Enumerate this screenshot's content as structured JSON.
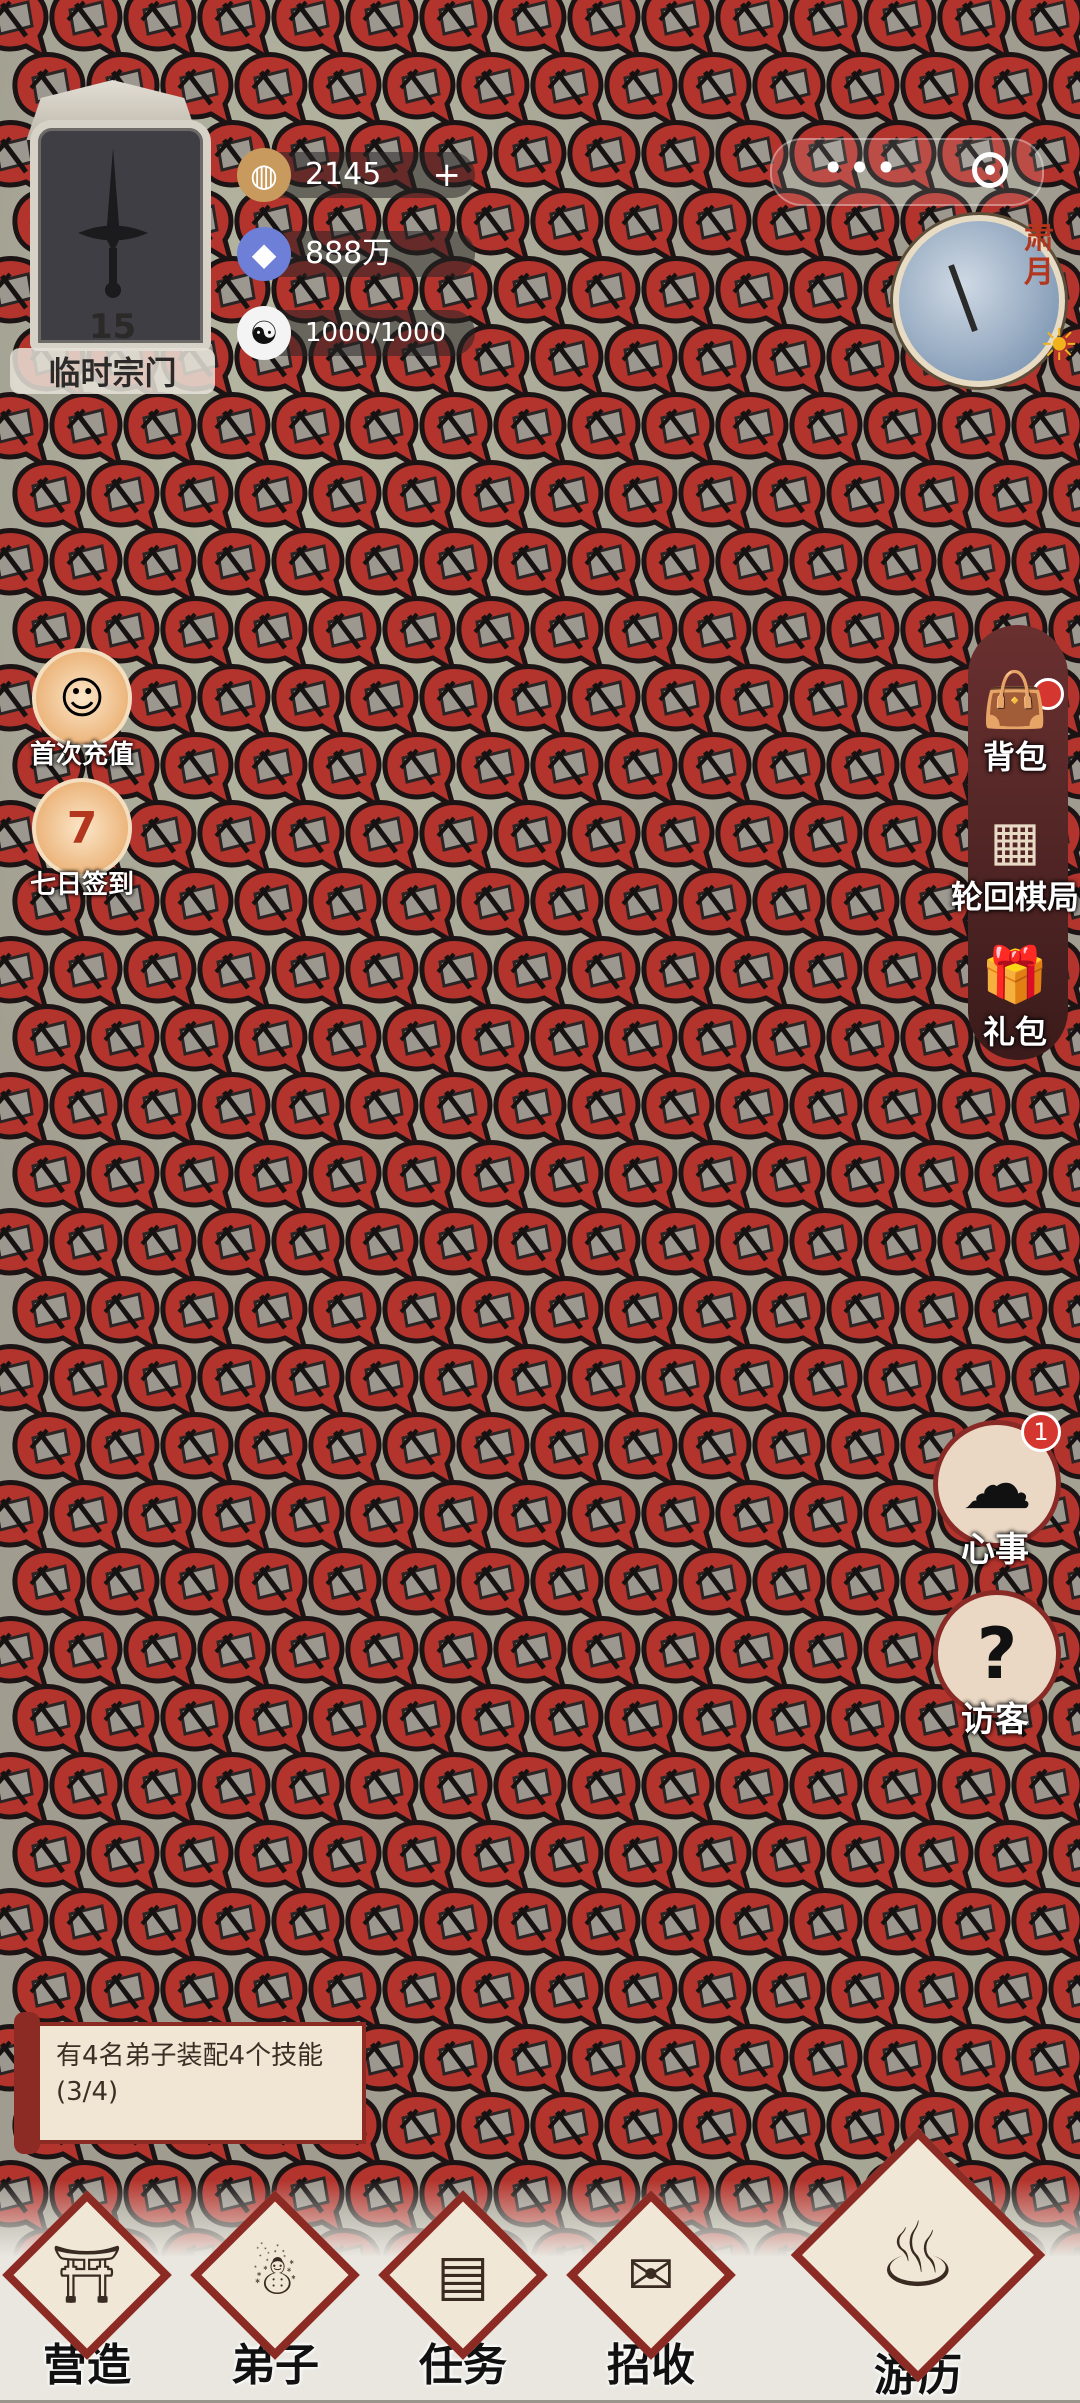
{
  "sect": {
    "level": "15",
    "name": "临时宗门"
  },
  "resources": [
    {
      "icon": "spirit-stone-icon",
      "value": "2145",
      "plus": "+"
    },
    {
      "icon": "crystal-icon",
      "value": "888万"
    },
    {
      "icon": "yin-yang-icon",
      "value": "1000/1000"
    }
  ],
  "season": "肃月",
  "events": [
    {
      "label": "首次充值",
      "icon": "character-portrait-icon"
    },
    {
      "label": "七日签到",
      "icon": "calendar-7-icon"
    }
  ],
  "right_menu": [
    {
      "label": "背包",
      "icon": "bag-icon"
    },
    {
      "label": "轮回棋局",
      "icon": "chessboard-icon"
    },
    {
      "label": "礼包",
      "icon": "gift-icon"
    }
  ],
  "side_round": [
    {
      "label": "心事",
      "badge": "1",
      "icon": "thought-cloud-icon"
    },
    {
      "label": "访客",
      "icon": "question-visitor-icon"
    }
  ],
  "quest": {
    "text": "有4名弟子装配4个技能(3/4)"
  },
  "tabs": [
    {
      "label": "营造",
      "icon": "pavilion-icon"
    },
    {
      "label": "弟子",
      "icon": "disciple-icon"
    },
    {
      "label": "任务",
      "icon": "scroll-icon"
    },
    {
      "label": "招收",
      "icon": "invitation-card-icon"
    },
    {
      "label": "游历",
      "icon": "travel-gourd-icon"
    }
  ],
  "colors": {
    "tile_red": "#b2342d",
    "frame_red": "#8c2a24",
    "paper": "#f1e6d4"
  }
}
